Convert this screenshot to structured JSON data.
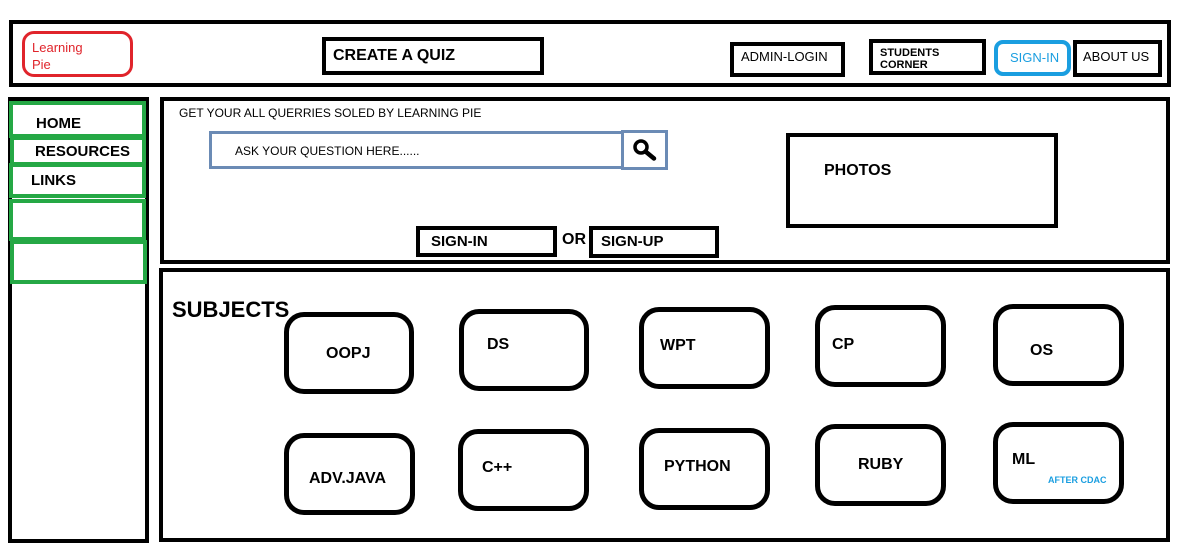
{
  "header": {
    "logo_line1": "Learning",
    "logo_line2": "Pie",
    "create_quiz": "CREATE A QUIZ",
    "admin_login": "ADMIN-LOGIN",
    "students_corner": "STUDENTS CORNER",
    "sign_in": "SIGN-IN",
    "about_us": "ABOUT US"
  },
  "sidebar": {
    "items": [
      {
        "label": "HOME"
      },
      {
        "label": "RESOURCES"
      },
      {
        "label": "LINKS"
      },
      {
        "label": ""
      },
      {
        "label": ""
      }
    ]
  },
  "hero": {
    "tagline": "GET YOUR ALL QUERRIES SOLED BY LEARNING PIE",
    "search_placeholder": "ASK YOUR QUESTION HERE......",
    "search_icon": "magnifier-icon",
    "photos_label": "PHOTOS",
    "sign_in": "SIGN-IN",
    "or": "OR",
    "sign_up": "SIGN-UP"
  },
  "subjects": {
    "title": "SUBJECTS",
    "items": [
      {
        "label": "OOPJ"
      },
      {
        "label": "DS"
      },
      {
        "label": "WPT"
      },
      {
        "label": "CP"
      },
      {
        "label": "OS"
      },
      {
        "label": "ADV.JAVA"
      },
      {
        "label": "C++"
      },
      {
        "label": "PYTHON"
      },
      {
        "label": "RUBY"
      },
      {
        "label": "ML",
        "note": "AFTER CDAC"
      }
    ]
  },
  "colors": {
    "logo": "#e0242b",
    "sign_in_accent": "#1a9ee0",
    "sidebar_border": "#25a845",
    "search_border": "#6b8bb5"
  }
}
